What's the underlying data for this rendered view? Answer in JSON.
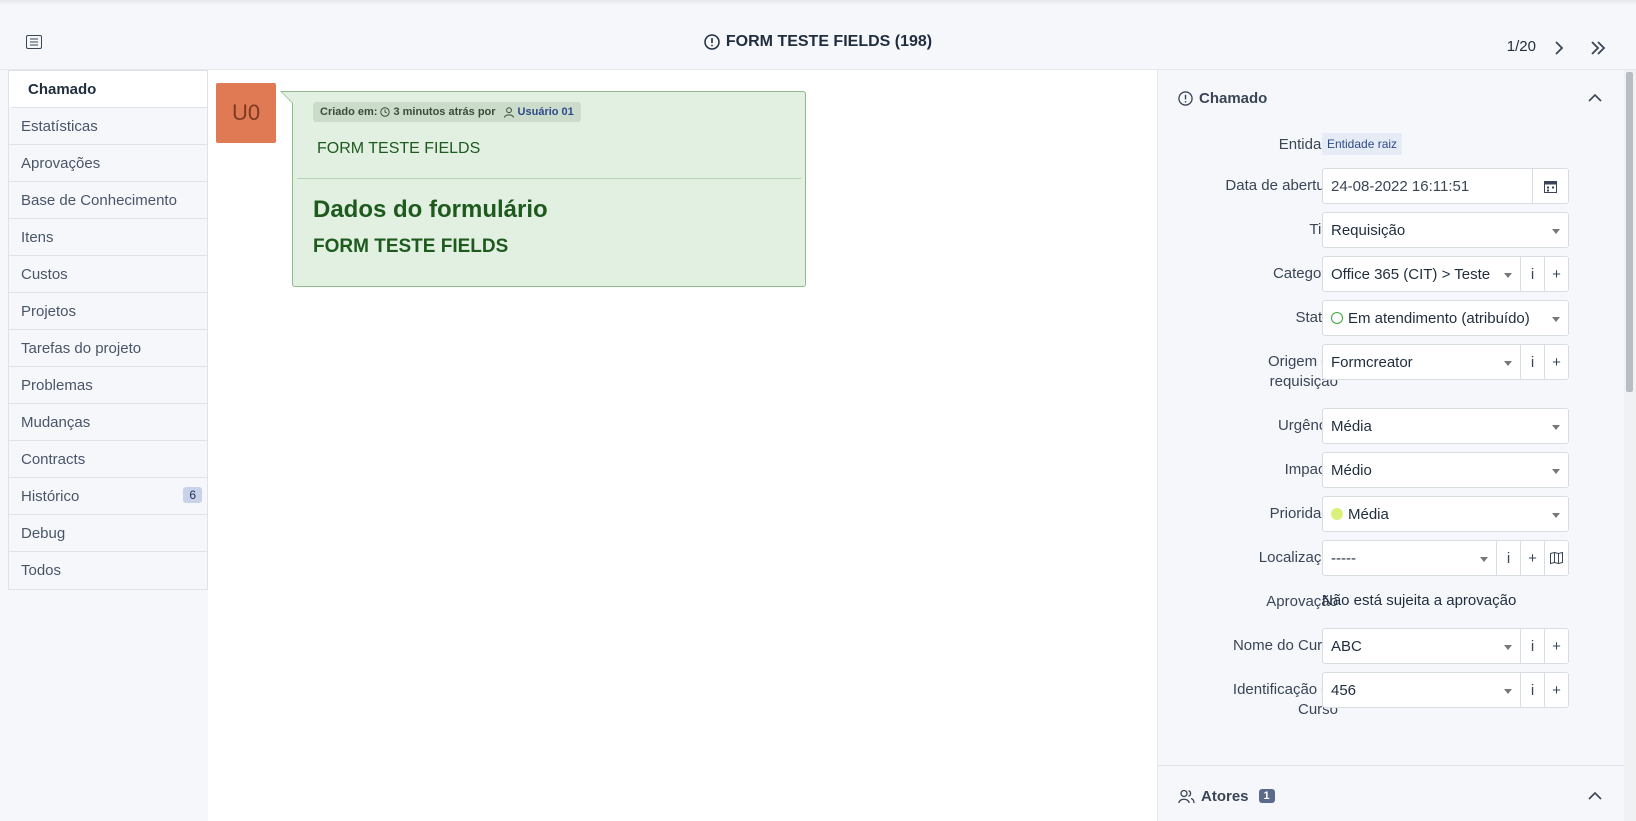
{
  "header": {
    "title": "FORM TESTE FIELDS (198)",
    "pager": "1/20"
  },
  "tabs": [
    {
      "label": "Chamado",
      "active": true
    },
    {
      "label": "Estatísticas"
    },
    {
      "label": "Aprovações"
    },
    {
      "label": "Base de Conhecimento"
    },
    {
      "label": "Itens"
    },
    {
      "label": "Custos"
    },
    {
      "label": "Projetos"
    },
    {
      "label": "Tarefas do projeto"
    },
    {
      "label": "Problemas"
    },
    {
      "label": "Mudanças"
    },
    {
      "label": "Contracts"
    },
    {
      "label": "Histórico",
      "badge": "6"
    },
    {
      "label": "Debug"
    },
    {
      "label": "Todos"
    }
  ],
  "timeline": {
    "avatar_initials": "U0",
    "meta_created": "Criado em:",
    "meta_time": "3 minutos atrás por",
    "meta_user": "Usuário 01",
    "item_title": "FORM TESTE FIELDS",
    "form_heading": "Dados do formulário",
    "form_subheading": "FORM TESTE FIELDS"
  },
  "panel": {
    "section_title": "Chamado",
    "fields": {
      "entidade": {
        "label": "Entidade",
        "value": "Entidade raiz"
      },
      "data_abertura": {
        "label": "Data de abertura",
        "value": "24-08-2022 16:11:51"
      },
      "tipo": {
        "label": "Tipo",
        "value": "Requisição"
      },
      "categoria": {
        "label": "Categoria",
        "value": "Office 365 (CIT) > Teste"
      },
      "status": {
        "label": "Status",
        "value": "Em atendimento (atribuído)"
      },
      "origem": {
        "label_line1": "Origem da",
        "label_line2": "requisição",
        "value": "Formcreator"
      },
      "urgencia": {
        "label": "Urgência",
        "value": "Média"
      },
      "impacto": {
        "label": "Impacto",
        "value": "Médio"
      },
      "prioridade": {
        "label": "Prioridade",
        "value": "Média"
      },
      "localizacao": {
        "label": "Localização",
        "value": "-----"
      },
      "aprovacao": {
        "label": "Aprovação",
        "value": "Não está sujeita a aprovação"
      },
      "nome_curso": {
        "label": "Nome do Curso",
        "value": "ABC"
      },
      "id_curso": {
        "label_line1": "Identificação do",
        "label_line2": "Curso",
        "value": "456"
      }
    },
    "actors": {
      "title": "Atores",
      "count": "1"
    },
    "addon_info": "i",
    "addon_add": "+"
  },
  "colors": {
    "avatar": "#e07a55",
    "bubble_bg": "#e2f0e2",
    "bubble_text": "#1e5a1e",
    "status_ring": "#3aa83a",
    "priority_dot": "#d9f07a",
    "accent": "#2e4a8a"
  },
  "icons": {
    "toggle": "list-icon",
    "title": "alert-circle-icon",
    "next": "chevron-right-icon",
    "last": "chevrons-right-icon",
    "calendar": "calendar-icon",
    "map": "map-icon",
    "collapse": "chevron-up-icon",
    "actors": "users-icon"
  }
}
